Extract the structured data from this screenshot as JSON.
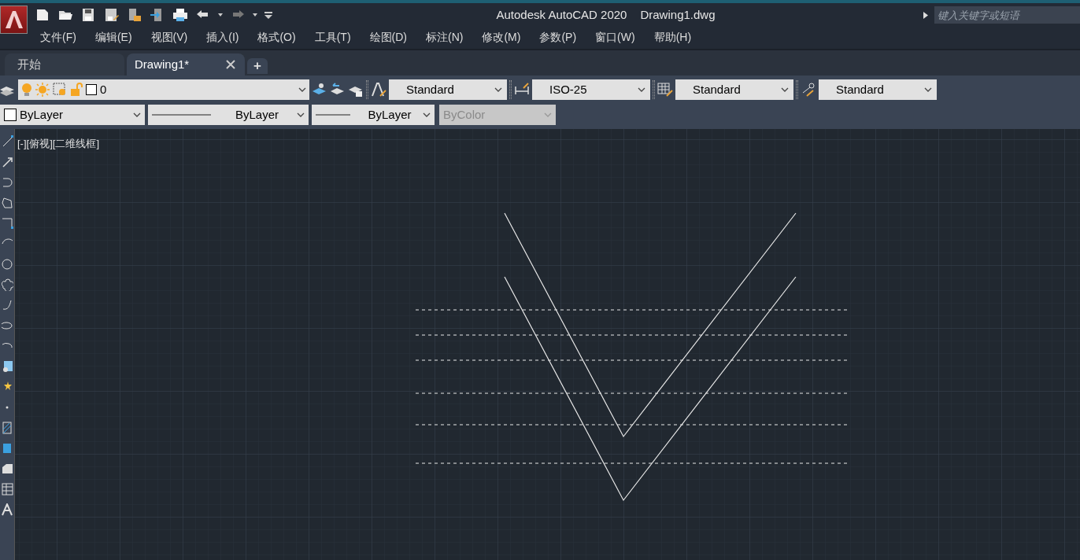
{
  "window": {
    "title_app": "Autodesk AutoCAD 2020",
    "title_file": "Drawing1.dwg"
  },
  "search": {
    "placeholder": "键入关键字或短语"
  },
  "menu": [
    "文件(F)",
    "编辑(E)",
    "视图(V)",
    "插入(I)",
    "格式(O)",
    "工具(T)",
    "绘图(D)",
    "标注(N)",
    "修改(M)",
    "参数(P)",
    "窗口(W)",
    "帮助(H)"
  ],
  "tabs": [
    {
      "label": "开始",
      "selected": false
    },
    {
      "label": "Drawing1*",
      "selected": true
    }
  ],
  "new_tab": "+",
  "layer_dropdown": {
    "value": "0"
  },
  "style_dropdowns": [
    {
      "kind": "text",
      "value": "Standard"
    },
    {
      "kind": "dimension",
      "value": "ISO-25"
    },
    {
      "kind": "table",
      "value": "Standard"
    },
    {
      "kind": "multileader",
      "value": "Standard"
    }
  ],
  "property_dropdowns": [
    {
      "kind": "color",
      "value": "ByLayer",
      "disabled": false
    },
    {
      "kind": "linetype",
      "value": "ByLayer",
      "disabled": false
    },
    {
      "kind": "lineweight",
      "value": "ByLayer",
      "disabled": false
    },
    {
      "kind": "plotstyle",
      "value": "ByColor",
      "disabled": true
    }
  ],
  "viewport_label": "[-][俯视][二维线框]"
}
